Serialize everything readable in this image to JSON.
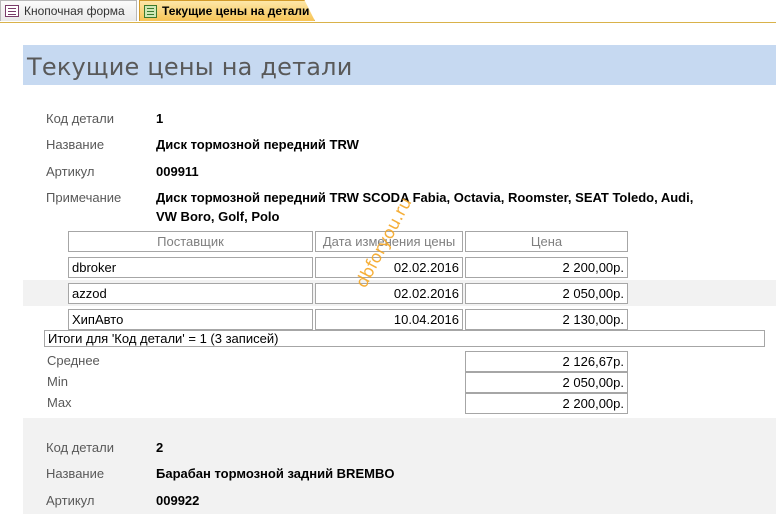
{
  "tabs": [
    {
      "label": "Кнопочная форма",
      "icon": "form-icon",
      "active": false
    },
    {
      "label": "Текущие цены на детали",
      "icon": "report-icon",
      "active": true
    }
  ],
  "report": {
    "title": "Текущие цены на детали",
    "labels": {
      "code": "Код детали",
      "name": "Название",
      "article": "Артикул",
      "note": "Примечание"
    },
    "columns": {
      "supplier": "Поставщик",
      "date": "Дата изменения цены",
      "price": "Цена"
    },
    "stat_labels": {
      "avg": "Среднее",
      "min": "Min",
      "max": "Max"
    },
    "records": [
      {
        "code": "1",
        "name": "Диск тормозной передний TRW",
        "article": "009911",
        "note_line1": "Диск тормозной передний TRW SCODA Fabia, Octavia, Roomster, SEAT Toledo, Audi,",
        "note_line2": "VW Boro, Golf, Polo",
        "rows": [
          {
            "supplier": "dbroker",
            "date": "02.02.2016",
            "price": "2 200,00р."
          },
          {
            "supplier": "azzod",
            "date": "02.02.2016",
            "price": "2 050,00р."
          },
          {
            "supplier": "ХипАвто",
            "date": "10.04.2016",
            "price": "2 130,00р."
          }
        ],
        "summary": "Итоги для 'Код детали' =  1 (3 записей)",
        "avg": "2 126,67р.",
        "min": "2 050,00р.",
        "max": "2 200,00р."
      },
      {
        "code": "2",
        "name": "Барабан тормозной задний BREMBO",
        "article": "009922"
      }
    ]
  },
  "watermark": "dbforyou.ru",
  "colors": {
    "header_band": "#c6d9f1",
    "active_tab": "#f7c456",
    "alt_row": "#f2f2f2",
    "watermark": "#f5a623"
  }
}
